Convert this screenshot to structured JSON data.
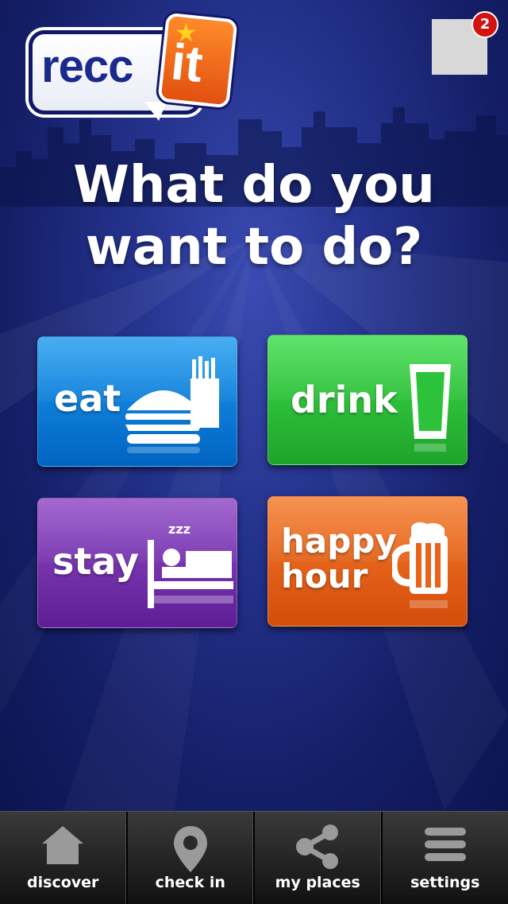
{
  "logo": {
    "text_recc": "recc",
    "text_it": "it"
  },
  "notifications": {
    "count": "2"
  },
  "headline": {
    "line1": "What do you",
    "line2": "want to do?"
  },
  "tiles": [
    {
      "label": "eat",
      "icon": "burger-fries-icon",
      "color": "#0a7fdc"
    },
    {
      "label": "drink",
      "icon": "glass-icon",
      "color": "#2cc23a"
    },
    {
      "label": "stay",
      "icon": "bed-icon",
      "color": "#7a33b0"
    },
    {
      "label_line1": "happy",
      "label_line2": "hour",
      "icon": "beer-mug-icon",
      "color": "#e8621a"
    }
  ],
  "tabbar": [
    {
      "label": "discover",
      "icon": "home-icon"
    },
    {
      "label": "check in",
      "icon": "location-pin-icon"
    },
    {
      "label": "my places",
      "icon": "share-icon"
    },
    {
      "label": "settings",
      "icon": "menu-icon"
    }
  ]
}
